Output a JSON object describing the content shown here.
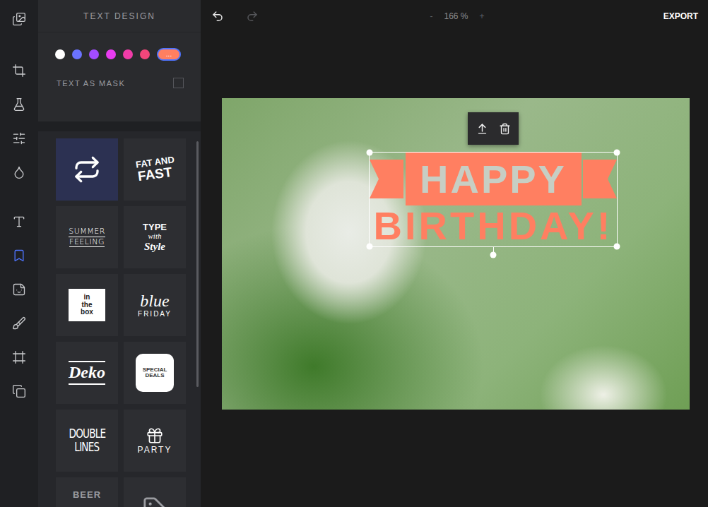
{
  "rail": {
    "groups": [
      [
        {
          "selected": false
        }
      ],
      [
        {
          "selected": false
        },
        {
          "selected": false
        },
        {
          "selected": false
        },
        {
          "selected": false
        }
      ],
      [
        {
          "selected": false
        },
        {
          "selected": true
        },
        {
          "selected": false
        },
        {
          "selected": false
        },
        {
          "selected": false
        },
        {
          "selected": false
        }
      ]
    ]
  },
  "panel": {
    "title": "TEXT DESIGN",
    "colors": [
      {
        "color": "#ffffff",
        "selected": false,
        "label": ""
      },
      {
        "color": "#6b73ff",
        "selected": false,
        "label": ""
      },
      {
        "color": "#a34cff",
        "selected": false,
        "label": ""
      },
      {
        "color": "#e83cf0",
        "selected": false,
        "label": ""
      },
      {
        "color": "#f03ca8",
        "selected": false,
        "label": ""
      },
      {
        "color": "#f2467a",
        "selected": false,
        "label": ""
      },
      {
        "color": "#ff7f61",
        "selected": true,
        "label": "..."
      }
    ],
    "mask": {
      "label": "TEXT AS MASK",
      "checked": false
    },
    "designs": [
      {
        "kind": "icon",
        "lines": [],
        "selected": true
      },
      {
        "kind": "slant",
        "lines": [
          "FAT AND",
          "FAST"
        ],
        "selected": false
      },
      {
        "kind": "thin",
        "lines": [
          "SUMMER",
          "FEELING"
        ],
        "selected": false
      },
      {
        "kind": "mixed",
        "lines": [
          "TYPE",
          "with",
          "Style"
        ],
        "selected": false
      },
      {
        "kind": "boxed",
        "lines": [
          "in",
          "the",
          "box"
        ],
        "selected": false
      },
      {
        "kind": "script",
        "lines": [
          "blue",
          "FRIDAY"
        ],
        "selected": false
      },
      {
        "kind": "brush",
        "lines": [
          "Deko"
        ],
        "selected": false
      },
      {
        "kind": "badge",
        "lines": [
          "SPECIAL",
          "DEALS"
        ],
        "selected": false
      },
      {
        "kind": "condensed",
        "lines": [
          "DOUBLE",
          "LINES"
        ],
        "selected": false
      },
      {
        "kind": "party",
        "lines": [
          "PARTY"
        ],
        "selected": false
      },
      {
        "kind": "cut",
        "lines": [
          "BEER"
        ],
        "selected": false
      },
      {
        "kind": "sign",
        "lines": [],
        "selected": false
      }
    ]
  },
  "topbar": {
    "undo": {
      "disabled": false
    },
    "redo": {
      "disabled": true
    },
    "zoom_out": "-",
    "zoom": "166 %",
    "zoom_in": "+",
    "export": "EXPORT"
  },
  "canvas": {
    "overlay": {
      "lines": [
        "HAPPY",
        "BIRTHDAY!"
      ],
      "selected": true,
      "color": "#ff7f61"
    }
  }
}
